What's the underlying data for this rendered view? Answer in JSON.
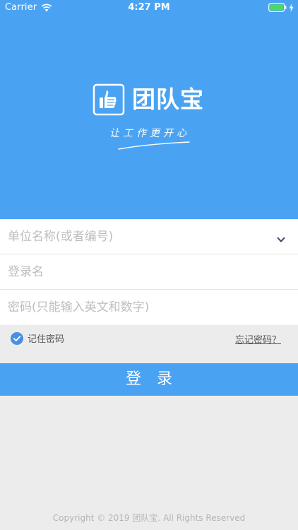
{
  "status_bar": {
    "carrier": "Carrier",
    "time": "4:27 PM",
    "icons": [
      "wifi-icon",
      "battery-icon",
      "charging-bolt-icon"
    ]
  },
  "brand": {
    "app_name": "团队宝",
    "slogan": "让工作更开心",
    "logo_icon": "thumbs-up-logo-icon",
    "color": "#4aa3f2"
  },
  "form": {
    "unit_placeholder": "单位名称(或者编号)",
    "username_placeholder": "登录名",
    "password_placeholder": "密码(只能输入英文和数字)",
    "unit_dropdown_icon": "chevron-down-icon"
  },
  "options": {
    "remember_label": "记住密码",
    "remember_checked": true,
    "forgot_label": "忘记密码？"
  },
  "login_button": {
    "label": "登录"
  },
  "footer": {
    "copyright": "Copyright © 2019 团队宝. All Rights Reserved"
  }
}
